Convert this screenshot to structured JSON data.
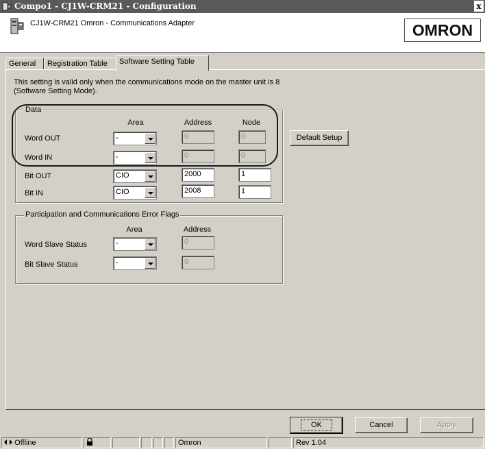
{
  "window": {
    "title": "Compo1 - CJ1W-CRM21 - Configuration",
    "close": "x"
  },
  "header": {
    "device_desc": "CJ1W-CRM21  Omron - Communications Adapter",
    "logo": "OMRON"
  },
  "tabs": [
    {
      "label": "General"
    },
    {
      "label": "Registration Table"
    },
    {
      "label": "Software Setting Table",
      "active": true
    }
  ],
  "note": {
    "line1": "This setting is valid only when the communications mode on the master unit is 8",
    "line2": "(Software Setting Mode)."
  },
  "data_group": {
    "title": "Data",
    "col_area": "Area",
    "col_address": "Address",
    "col_node": "Node",
    "rows": [
      {
        "label": "Word OUT",
        "area": "-",
        "address": "0",
        "node": "0"
      },
      {
        "label": "Word IN",
        "area": "-",
        "address": "0",
        "node": "0"
      },
      {
        "label": "Bit OUT",
        "area": "CIO",
        "address": "2000",
        "node": "1"
      },
      {
        "label": "Bit IN",
        "area": "CIO",
        "address": "2008",
        "node": "1"
      }
    ]
  },
  "flags_group": {
    "title": "Participation and Communications Error Flags",
    "col_area": "Area",
    "col_address": "Address",
    "rows": [
      {
        "label": "Word Slave Status",
        "area": "-",
        "address": "0"
      },
      {
        "label": "Bit Slave Status",
        "area": "-",
        "address": "0"
      }
    ]
  },
  "buttons": {
    "default_setup": "Default Setup",
    "ok": "OK",
    "cancel": "Cancel",
    "apply": "Apply"
  },
  "statusbar": {
    "mode": "Offline",
    "vendor": "Omron",
    "rev": "Rev 1.04"
  }
}
